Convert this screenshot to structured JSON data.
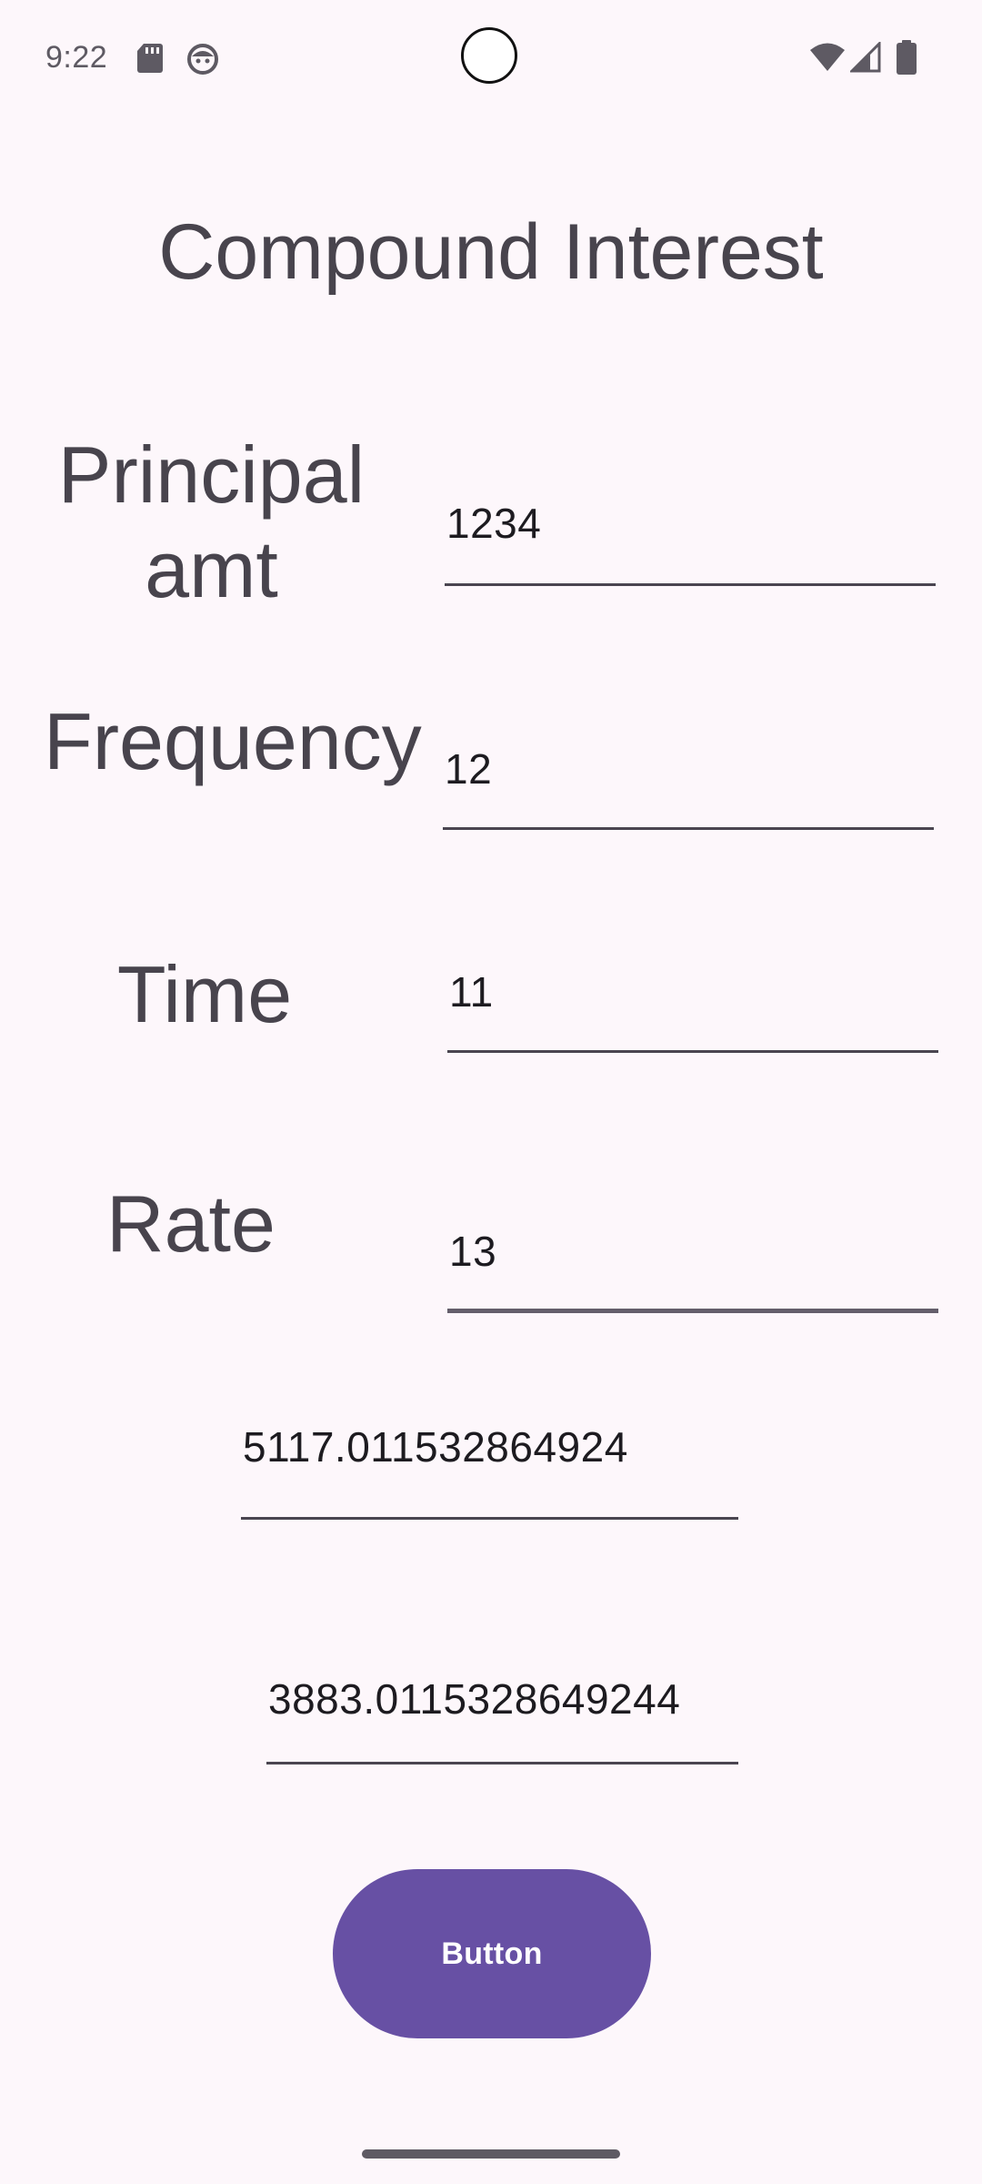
{
  "status_bar": {
    "time": "9:22"
  },
  "title": "Compound Interest",
  "form": {
    "principal": {
      "label": "Principal amt",
      "value": "1234"
    },
    "frequency": {
      "label": "Frequency",
      "value": "12"
    },
    "time": {
      "label": "Time",
      "value": "11"
    },
    "rate": {
      "label": "Rate",
      "value": "13"
    }
  },
  "results": {
    "total_amount": "5117.011532864924",
    "interest": "3883.0115328649244"
  },
  "button": {
    "label": "Button"
  },
  "colors": {
    "background": "#FDF7FB",
    "accent": "#6750A4",
    "text": "#48444D",
    "input_text": "#1D1B20"
  }
}
